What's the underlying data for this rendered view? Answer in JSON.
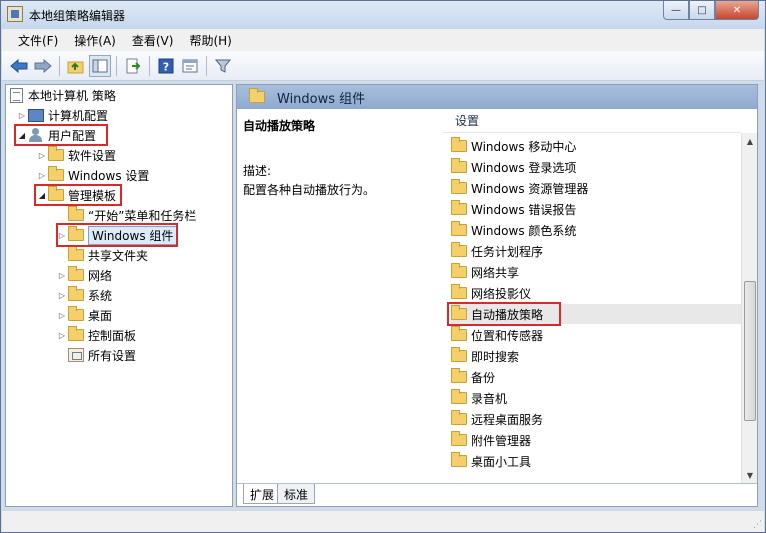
{
  "window": {
    "title": "本地组策略编辑器",
    "buttons": {
      "minimize": "—",
      "maximize": "□",
      "close": "✕"
    }
  },
  "menu": [
    "文件(F)",
    "操作(A)",
    "查看(V)",
    "帮助(H)"
  ],
  "toolbar": {
    "icons": [
      "back-arrow-icon",
      "forward-arrow-icon",
      "up-folder-icon",
      "show-hide-tree-icon",
      "export-list-icon",
      "help-icon",
      "properties-icon",
      "filter-icon"
    ]
  },
  "tree": {
    "root": "本地计算机 策略",
    "computer_config": "计算机配置",
    "user_config": "用户配置",
    "software_settings": "软件设置",
    "windows_settings": "Windows 设置",
    "admin_templates": "管理模板",
    "start_menu": "“开始”菜单和任务栏",
    "windows_components": "Windows 组件",
    "shared_folders": "共享文件夹",
    "network": "网络",
    "system": "系统",
    "desktop": "桌面",
    "control_panel": "控制面板",
    "all_settings": "所有设置"
  },
  "right_pane": {
    "header": "Windows 组件",
    "description": {
      "title": "自动播放策略",
      "label": "描述:",
      "text": "配置各种自动播放行为。"
    },
    "list_header": "设置",
    "items": [
      "Windows 移动中心",
      "Windows 登录选项",
      "Windows 资源管理器",
      "Windows 错误报告",
      "Windows 颜色系统",
      "任务计划程序",
      "网络共享",
      "网络投影仪",
      "自动播放策略",
      "位置和传感器",
      "即时搜索",
      "备份",
      "录音机",
      "远程桌面服务",
      "附件管理器",
      "桌面小工具"
    ],
    "selected_item": "自动播放策略"
  },
  "tabs": {
    "extended": "扩展",
    "standard": "标准"
  },
  "colors": {
    "highlight_box": "#d72a2a",
    "header_bg": "#9fb8d8",
    "selected_tree": "#ddebf8"
  }
}
